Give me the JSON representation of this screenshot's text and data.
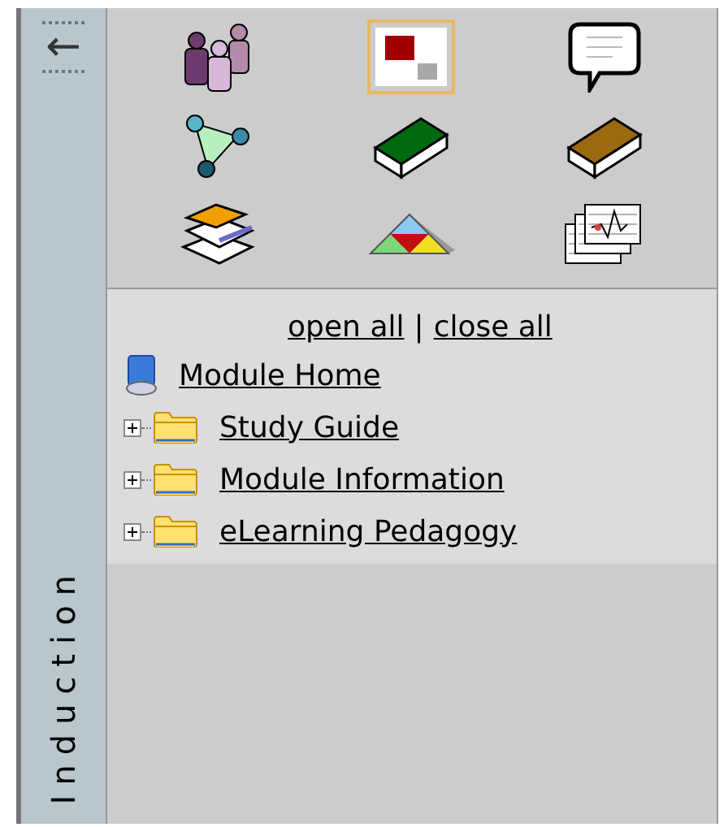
{
  "sidebar": {
    "label": "Induction",
    "collapse_arrow": "←"
  },
  "tools": [
    {
      "kind": "people",
      "selected": false
    },
    {
      "kind": "slides",
      "selected": true
    },
    {
      "kind": "speech",
      "selected": false
    },
    {
      "kind": "network",
      "selected": false
    },
    {
      "kind": "green-book",
      "selected": false
    },
    {
      "kind": "brown-book",
      "selected": false
    },
    {
      "kind": "stack",
      "selected": false
    },
    {
      "kind": "pyramid",
      "selected": false
    },
    {
      "kind": "charts",
      "selected": false
    }
  ],
  "tree": {
    "open_all": "open all",
    "separator": "|",
    "close_all": "close all",
    "items": [
      {
        "kind": "home",
        "label": "Module Home"
      },
      {
        "kind": "folder",
        "label": "Study Guide",
        "expanded": false
      },
      {
        "kind": "folder",
        "label": "Module Information",
        "expanded": false
      },
      {
        "kind": "folder",
        "label": "eLearning Pedagogy",
        "expanded": false
      }
    ]
  }
}
